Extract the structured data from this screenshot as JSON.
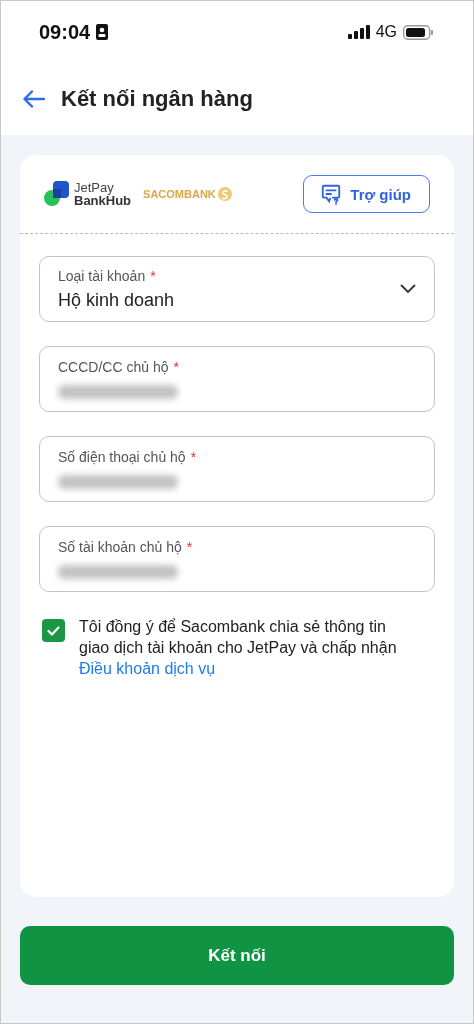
{
  "status_bar": {
    "time": "09:04",
    "network": "4G"
  },
  "header": {
    "title": "Kết nối ngân hàng"
  },
  "brand": {
    "jetpay_line1": "JetPay",
    "jetpay_line2": "BankHub",
    "bank": "SACOMBANK",
    "help_button": "Trợ giúp"
  },
  "fields": [
    {
      "kind": "select",
      "label": "Loại tài khoản",
      "required_mark": "*",
      "value": "Hộ kinh doanh"
    },
    {
      "kind": "hidden",
      "label": "CCCD/CC chủ hộ",
      "required_mark": "*"
    },
    {
      "kind": "hidden",
      "label": "Số điện thoại chủ hộ",
      "required_mark": "*"
    },
    {
      "kind": "hidden",
      "label": "Số tài khoản chủ hộ",
      "required_mark": "*"
    }
  ],
  "agreement": {
    "checked": true,
    "text": "Tôi đồng ý để Sacombank chia sẻ thông tin giao dịch tài khoản cho JetPay và chấp nhận ",
    "link": "Điều khoản dịch vụ"
  },
  "submit_button": "Kết nối"
}
